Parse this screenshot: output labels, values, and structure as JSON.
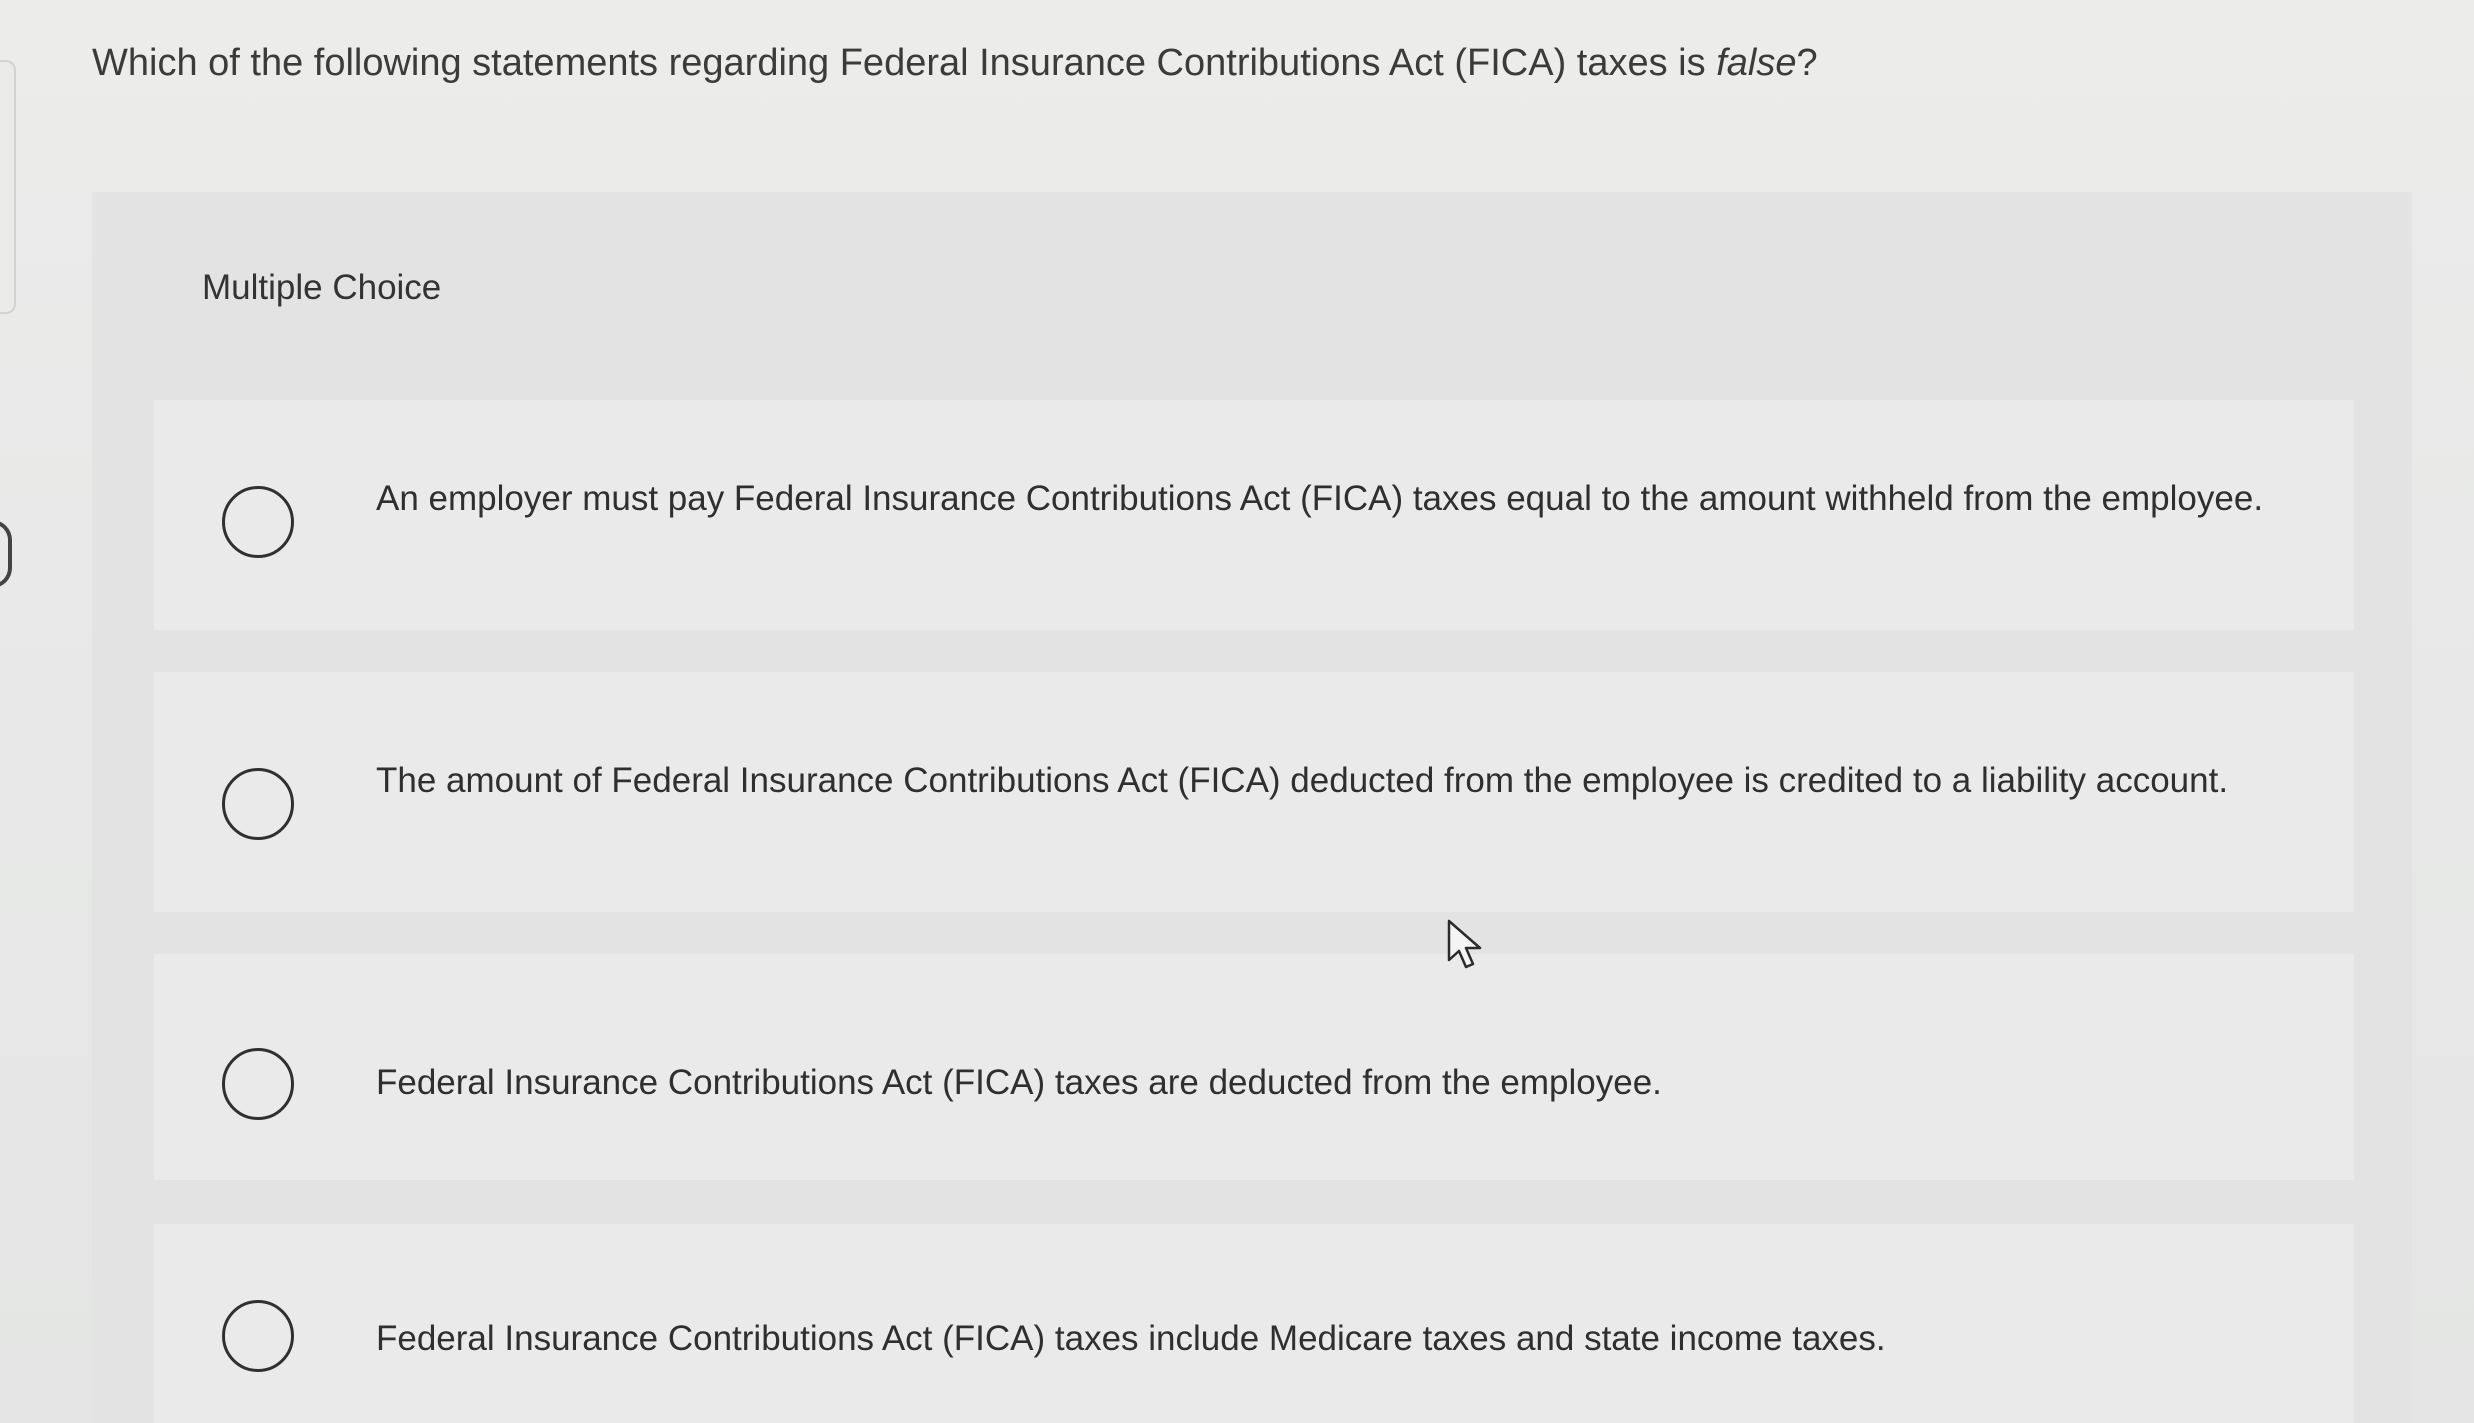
{
  "question": {
    "prefix": "Which of the following statements regarding Federal Insurance Contributions Act (FICA) taxes is ",
    "emphasis": "false",
    "suffix": "?"
  },
  "panel": {
    "header": "Multiple Choice"
  },
  "options": [
    {
      "text": "An employer must pay Federal Insurance Contributions Act (FICA) taxes equal to the amount withheld from the employee.",
      "selected": false
    },
    {
      "text": "The amount of Federal Insurance Contributions Act (FICA) deducted from the employee is credited to a liability account.",
      "selected": false
    },
    {
      "text": "Federal Insurance Contributions Act (FICA) taxes are deducted from the employee.",
      "selected": false
    },
    {
      "text": "Federal Insurance Contributions Act (FICA) taxes include Medicare taxes and state income taxes.",
      "selected": false
    }
  ],
  "icons": {
    "radio": "radio-unselected-icon",
    "cursor": "mouse-pointer-icon"
  }
}
